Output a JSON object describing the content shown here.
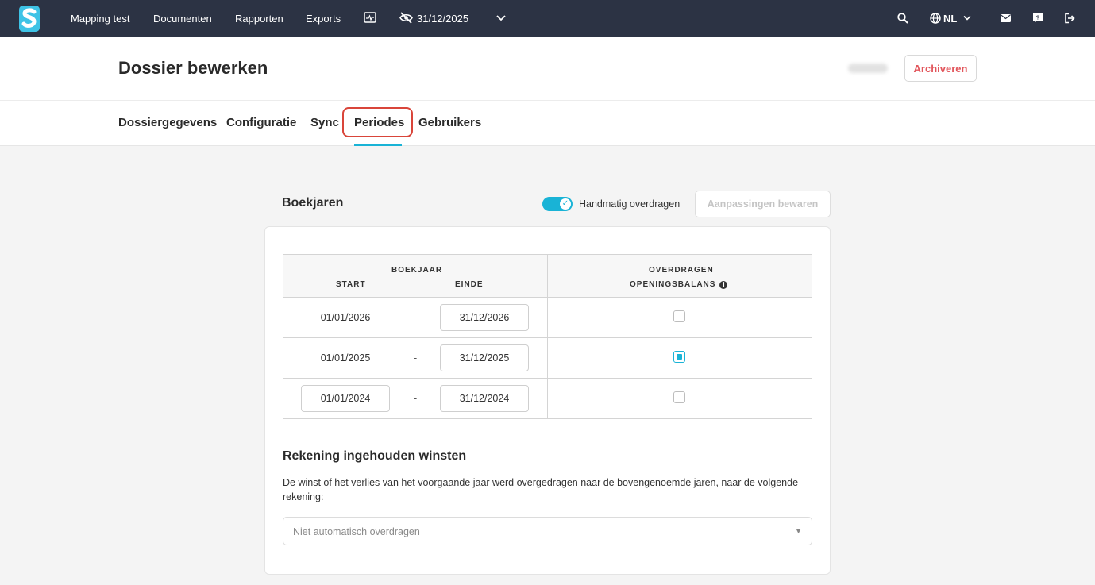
{
  "nav": {
    "items": [
      "Mapping test",
      "Documenten",
      "Rapporten",
      "Exports"
    ],
    "date": "31/12/2025",
    "language": "NL"
  },
  "header": {
    "title": "Dossier bewerken",
    "archive_label": "Archiveren"
  },
  "tabs": [
    "Dossiergegevens",
    "Configuratie",
    "Sync",
    "Periodes",
    "Gebruikers"
  ],
  "active_tab": "Periodes",
  "boekjaren": {
    "title": "Boekjaren",
    "toggle_label": "Handmatig overdragen",
    "toggle_on": true,
    "save_label": "Aanpassingen bewaren",
    "table": {
      "group_header": "BOEKJAAR",
      "col_start": "START",
      "col_end": "EINDE",
      "col_transfer_1": "OVERDRAGEN",
      "col_transfer_2": "OPENINGSBALANS",
      "separator": "-",
      "rows": [
        {
          "start": "01/01/2026",
          "end": "31/12/2026",
          "transfer": false,
          "start_editable": false
        },
        {
          "start": "01/01/2025",
          "end": "31/12/2025",
          "transfer": true,
          "start_editable": false
        },
        {
          "start": "01/01/2024",
          "end": "31/12/2024",
          "transfer": false,
          "start_editable": true
        }
      ]
    }
  },
  "retained": {
    "title": "Rekening ingehouden winsten",
    "description": "De winst of het verlies van het voorgaande jaar werd overgedragen naar de bovengenoemde jaren, naar de volgende rekening:",
    "select_value": "Niet automatisch overdragen"
  },
  "colors": {
    "nav_bg": "#2c3344",
    "accent": "#19b3d6",
    "danger": "#e2555b",
    "highlight": "#d9453a"
  }
}
